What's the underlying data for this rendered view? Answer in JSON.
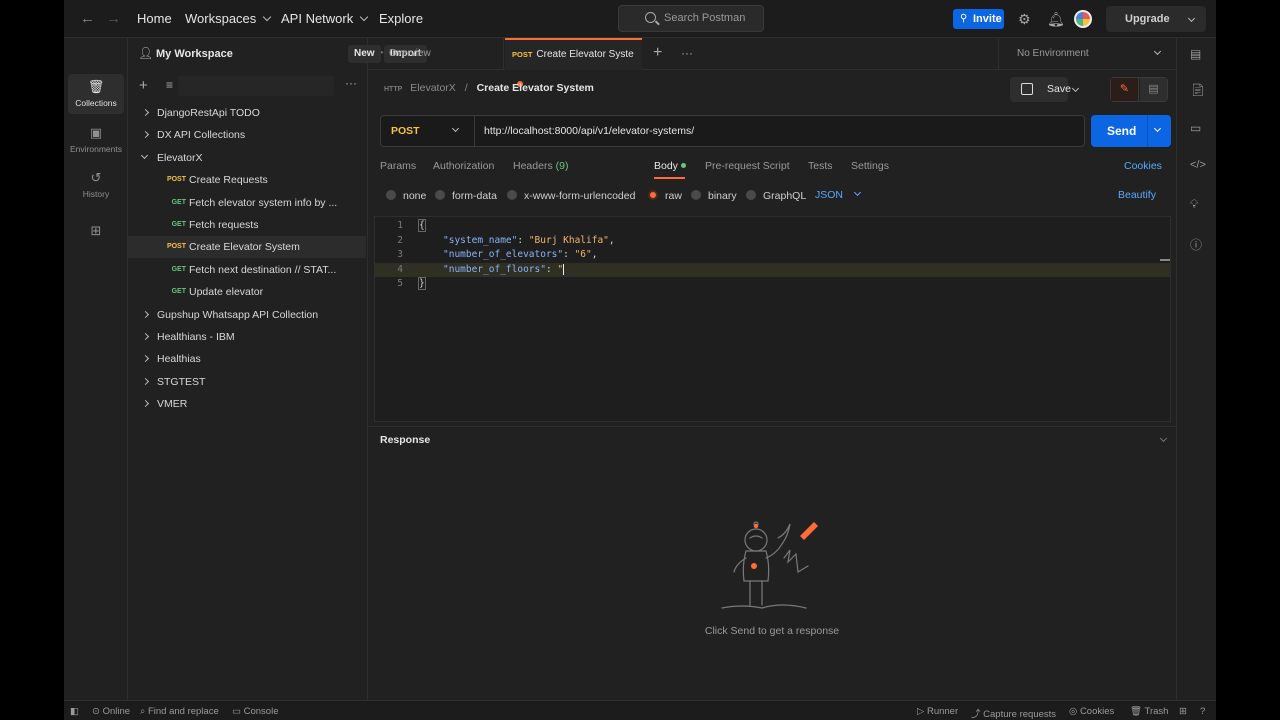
{
  "topbar": {
    "nav": [
      "Home",
      "Workspaces",
      "API Network",
      "Explore"
    ],
    "search_placeholder": "Search Postman",
    "invite_label": "Invite",
    "upgrade_label": "Upgrade"
  },
  "rail": {
    "items": [
      {
        "label": "Collections",
        "icon": "trash-icon"
      },
      {
        "label": "Environments",
        "icon": "environment-icon"
      },
      {
        "label": "History",
        "icon": "history-icon"
      },
      {
        "label": "",
        "icon": "apps-icon"
      }
    ]
  },
  "workspace": {
    "title": "My Workspace",
    "new_label": "New",
    "import_label": "Import"
  },
  "tree": [
    {
      "label": "DjangoRestApi TODO",
      "type": "collection",
      "expanded": false
    },
    {
      "label": "DX API Collections",
      "type": "collection",
      "expanded": false
    },
    {
      "label": "ElevatorX",
      "type": "collection",
      "expanded": true
    },
    {
      "label": "Create Requests",
      "type": "request",
      "method": "POST"
    },
    {
      "label": "Fetch elevator system info by ...",
      "type": "request",
      "method": "GET"
    },
    {
      "label": "Fetch requests",
      "type": "request",
      "method": "GET"
    },
    {
      "label": "Create Elevator System",
      "type": "request",
      "method": "POST",
      "selected": true
    },
    {
      "label": "Fetch next destination // STAT...",
      "type": "request",
      "method": "GET"
    },
    {
      "label": "Update elevator",
      "type": "request",
      "method": "GET"
    },
    {
      "label": "Gupshup Whatsapp API Collection",
      "type": "collection",
      "expanded": false
    },
    {
      "label": "Healthians - IBM",
      "type": "collection",
      "expanded": false
    },
    {
      "label": "Healthias",
      "type": "collection",
      "expanded": false
    },
    {
      "label": "STGTEST",
      "type": "collection",
      "expanded": false
    },
    {
      "label": "VMER",
      "type": "collection",
      "expanded": false
    }
  ],
  "tabs": {
    "overview_label": "Overview",
    "active_method": "POST",
    "active_label": "Create Elevator Syste",
    "environment": "No Environment"
  },
  "request": {
    "breadcrumb_http": "HTTP",
    "breadcrumb_parent": "ElevatorX",
    "breadcrumb_sep": "/",
    "breadcrumb_current": "Create Elevator System",
    "save_label": "Save",
    "method": "POST",
    "url": "http://localhost:8000/api/v1/elevator-systems/",
    "send_label": "Send",
    "tabs": {
      "params": "Params",
      "authorization": "Authorization",
      "headers": "Headers",
      "headers_count": "(9)",
      "body": "Body",
      "prerequest": "Pre-request Script",
      "tests": "Tests",
      "settings": "Settings"
    },
    "cookies_label": "Cookies",
    "body_types": {
      "none": "none",
      "form_data": "form-data",
      "urlencoded": "x-www-form-urlencoded",
      "raw": "raw",
      "binary": "binary",
      "graphql": "GraphQL"
    },
    "body_format": "JSON",
    "beautify_label": "Beautify",
    "code": {
      "line_numbers": [
        "1",
        "2",
        "3",
        "4",
        "5"
      ],
      "open_brace": "{",
      "close_brace": "}",
      "l2_key": "\"system_name\"",
      "l2_val": "\"Burj Khalifa\"",
      "l3_key": "\"number_of_elevators\"",
      "l3_val": "\"6\"",
      "l4_key": "\"number_of_floors\"",
      "l4_val": "\""
    }
  },
  "response": {
    "title": "Response",
    "empty_message": "Click Send to get a response"
  },
  "statusbar": {
    "online": "Online",
    "find_replace": "Find and replace",
    "console": "Console",
    "runner": "Runner",
    "capture": "Capture requests",
    "cookies": "Cookies",
    "trash": "Trash"
  }
}
